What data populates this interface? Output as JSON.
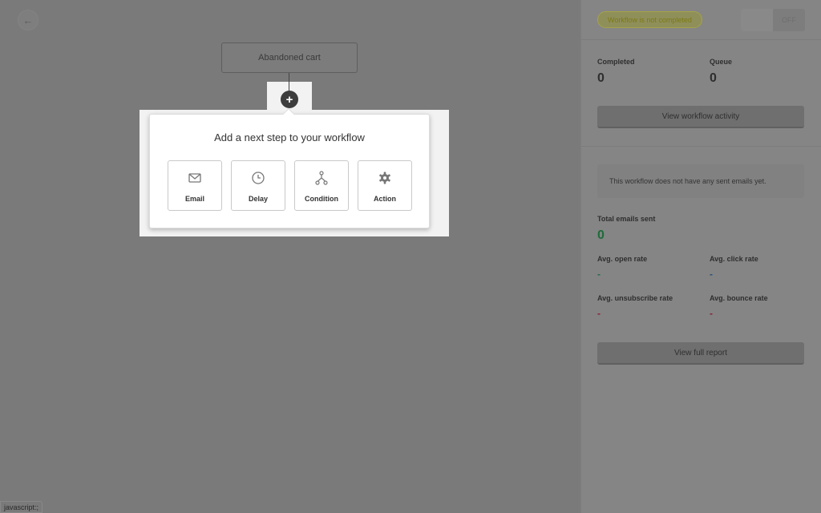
{
  "canvas": {
    "back_icon": "arrow-left-icon",
    "trigger_label": "Abandoned cart",
    "add_step_icon": "plus-icon",
    "popup": {
      "title": "Add a next step to your workflow",
      "options": [
        {
          "label": "Email",
          "icon": "envelope-icon"
        },
        {
          "label": "Delay",
          "icon": "clock-icon"
        },
        {
          "label": "Condition",
          "icon": "branch-icon"
        },
        {
          "label": "Action",
          "icon": "gear-icon"
        }
      ]
    }
  },
  "panel": {
    "status_badge": "Workflow is not completed",
    "toggle_label": "OFF",
    "completed_label": "Completed",
    "completed_value": "0",
    "queue_label": "Queue",
    "queue_value": "0",
    "activity_button": "View workflow activity",
    "no_emails_note": "This workflow does not have any sent emails yet.",
    "total_sent_label": "Total emails sent",
    "total_sent_value": "0",
    "open_rate_label": "Avg. open rate",
    "open_rate_value": "-",
    "click_rate_label": "Avg. click rate",
    "click_rate_value": "-",
    "unsub_rate_label": "Avg. unsubscribe rate",
    "unsub_rate_value": "-",
    "bounce_rate_label": "Avg. bounce rate",
    "bounce_rate_value": "-",
    "report_button": "View full report",
    "colors": {
      "badge": "#a4a34a",
      "total_sent": "#1f6b3a",
      "open": "#1f6b4a",
      "click": "#2a4f7a",
      "negative": "#8a1f35"
    }
  },
  "status_bar": "javascript:;"
}
